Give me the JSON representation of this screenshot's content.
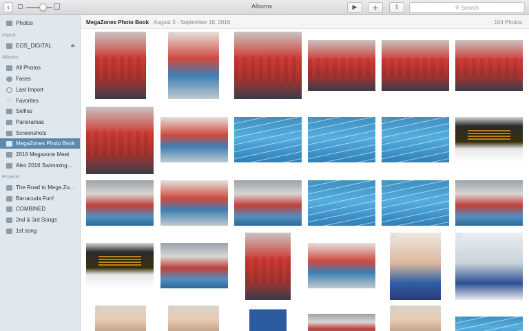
{
  "window": {
    "title": "Albums"
  },
  "toolbar": {
    "back_glyph": "‹",
    "play_glyph": "▶",
    "add_glyph": "+",
    "share_glyph": "⇪",
    "search_glyph": "⚲",
    "search_placeholder": "Search"
  },
  "sidebar": {
    "photos": "Photos",
    "import_header": "Import",
    "import_device": "EOS_DIGITAL",
    "eject_glyph": "⏏",
    "albums_header": "Albums",
    "albums": [
      {
        "label": "All Photos",
        "icon": "photos-icon"
      },
      {
        "label": "Faces",
        "icon": "faces-icon"
      },
      {
        "label": "Last Import",
        "icon": "clock-icon"
      },
      {
        "label": "Favorites",
        "icon": "heart-icon"
      },
      {
        "label": "Selfies",
        "icon": "selfies-icon"
      },
      {
        "label": "Panoramas",
        "icon": "panorama-icon"
      },
      {
        "label": "Screenshots",
        "icon": "screenshot-icon"
      },
      {
        "label": "MegaZones Photo Book",
        "icon": "book-icon",
        "selected": true
      },
      {
        "label": "2016 Megazone Meet",
        "icon": "album-icon"
      },
      {
        "label": "Alex 2016 Swimming...",
        "icon": "album-icon"
      }
    ],
    "projects_header": "Projects",
    "projects": [
      {
        "label": "The Road to Mega Zo..."
      },
      {
        "label": "Barracuda Fun!"
      },
      {
        "label": "COMBINED"
      },
      {
        "label": "2nd  & 3rd Songs"
      },
      {
        "label": "1st song"
      }
    ]
  },
  "album": {
    "title": "MegaZones Photo Book",
    "dates": "August 3 - September 18, 2016",
    "count": "104 Photos"
  },
  "heart_glyph": "♡",
  "accent_color": "#5a8ab0"
}
